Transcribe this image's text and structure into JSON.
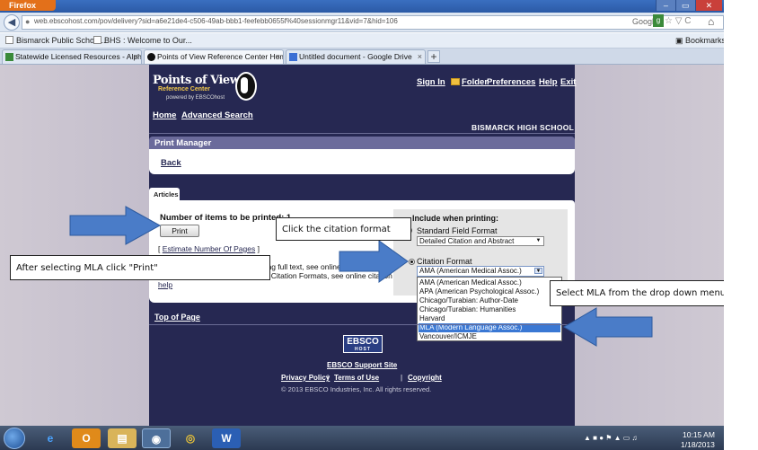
{
  "browser": {
    "app_button": "Firefox",
    "window_controls": [
      "–",
      "▭",
      "✕"
    ],
    "url": "web.ebscohost.com/pov/delivery?sid=a6e21de4-c506-49ab-bbb1-feefebb0655f%40sessionmgr11&vid=7&hid=106",
    "search_engine": "Google",
    "bookmarks": [
      "Bismarck Public Schoo...",
      "BHS : Welcome to Our..."
    ],
    "bookmarks_menu": "Bookmarks",
    "tabs": [
      {
        "label": "Statewide Licensed Resources - Alpha...",
        "active": false
      },
      {
        "label": "Points of View Reference Center Home",
        "active": true
      },
      {
        "label": "Untitled document - Google Drive",
        "active": false
      }
    ],
    "new_tab": "+"
  },
  "site": {
    "logo": {
      "title": "Points of View",
      "subtitle": "Reference Center",
      "tagline": "powered by EBSCOhost"
    },
    "top_links": {
      "sign_in": "Sign In",
      "folder": "Folder",
      "preferences": "Preferences",
      "help": "Help",
      "exit": "Exit"
    },
    "nav": {
      "home": "Home",
      "advanced_search": "Advanced Search"
    },
    "school": "BISMARCK HIGH SCHOOL",
    "print_manager": {
      "title": "Print Manager",
      "back": "Back"
    },
    "articles_tab": "Articles",
    "left_panel": {
      "number_label": "Number of items to be printed: 1",
      "print_button": "Print",
      "estimate_prefix": "[ ",
      "estimate_link": "Estimate Number Of Pages",
      "estimate_suffix": " ]",
      "info_line1": "For more information on printing full text, see online",
      "info_line2": "For more information on using Citation Formats, see online citation",
      "info_line3": "help"
    },
    "right_panel": {
      "include_label": "Include when printing:",
      "standard_label": "Standard Field Format",
      "standard_value": "Detailed Citation and Abstract",
      "citation_label": "Citation Format",
      "citation_value": "AMA (American Medical Assoc.)",
      "citation_options": [
        "AMA (American Medical Assoc.)",
        "APA (American Psychological Assoc.)",
        "Chicago/Turabian: Author-Date",
        "Chicago/Turabian: Humanities",
        "Harvard",
        "MLA (Modern Language Assoc.)",
        "Vancouver/ICMJE"
      ],
      "selected_option": "MLA (Modern Language Assoc.)"
    },
    "top_of_page": "Top of Page",
    "footer": {
      "logo_main": "EBSCO",
      "logo_sub": "HOST",
      "support": "EBSCO Support Site",
      "privacy": "Privacy Policy",
      "terms": "Terms of Use",
      "copyright_link": "Copyright",
      "separator": "|",
      "copyright": "© 2013 EBSCO Industries, Inc. All rights reserved."
    }
  },
  "callouts": {
    "citation": "Click the citation format",
    "mla_print": "After selecting MLA click \"Print\"",
    "select_mla": "Select MLA from the drop down menu."
  },
  "taskbar": {
    "clock_time": "10:15 AM",
    "clock_date": "1/18/2013"
  },
  "colors": {
    "site_bg": "#262852",
    "panel_header": "#6b6b9b",
    "arrow_blue": "#4a7cc8",
    "selection_blue": "#3a78d4"
  }
}
